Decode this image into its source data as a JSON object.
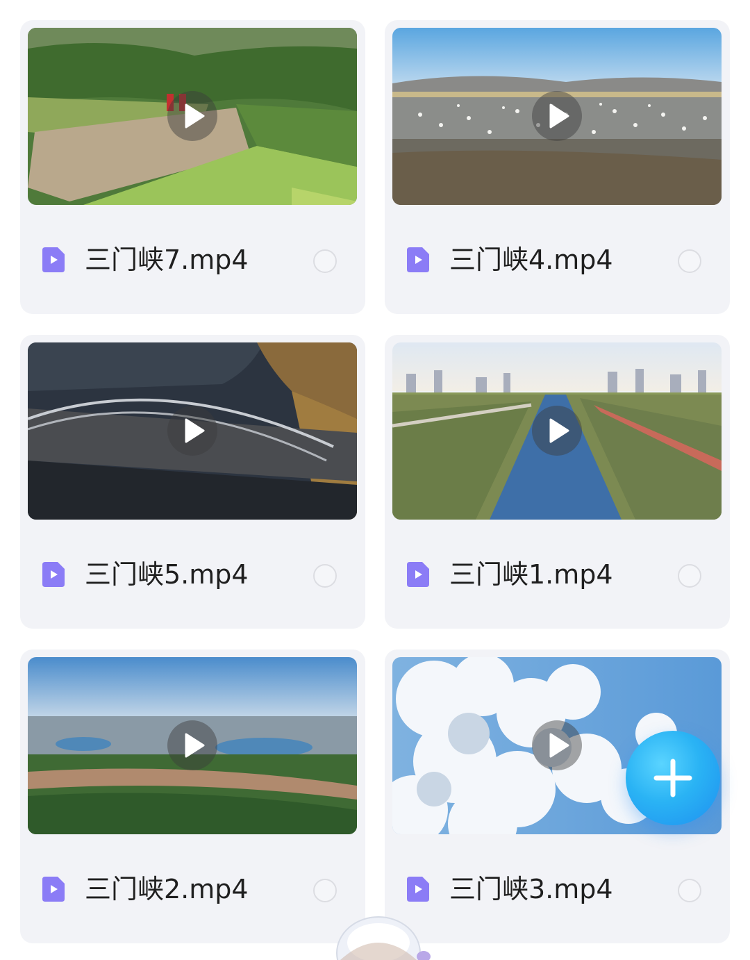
{
  "files": [
    {
      "name": "三门峡7.mp4",
      "scene": "dam",
      "selected": false
    },
    {
      "name": "三门峡4.mp4",
      "scene": "swans",
      "selected": false
    },
    {
      "name": "三门峡5.mp4",
      "scene": "bridge",
      "selected": false
    },
    {
      "name": "三门峡1.mp4",
      "scene": "river-city",
      "selected": false
    },
    {
      "name": "三门峡2.mp4",
      "scene": "aerial-river",
      "selected": false
    },
    {
      "name": "三门峡3.mp4",
      "scene": "clouds",
      "selected": false
    }
  ],
  "icons": {
    "play": "play-icon",
    "file": "video-file-icon",
    "radio": "radio-unchecked-icon",
    "add": "plus-icon"
  },
  "colors": {
    "card_bg": "#f2f3f7",
    "file_icon": "#8b7cf6",
    "fab": "#2ab3f4"
  }
}
